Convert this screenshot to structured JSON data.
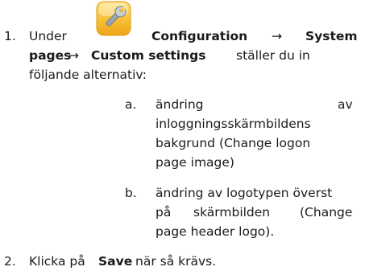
{
  "step1": {
    "number": "1.",
    "under": "Under",
    "configuration": "Configuration",
    "arrow1": "→",
    "system": "System",
    "pages": "pages",
    "arrow2": "→",
    "custom_settings": "Custom settings",
    "staller": "ställer du in",
    "following": "följande alternativ:",
    "icon": "wrench-settings-icon",
    "icon_color": "#f4b71b"
  },
  "sub_a": {
    "letter": "a.",
    "lines": [
      "ändring",
      "av",
      "inloggningsskärmbildens",
      "bakgrund (Change logon",
      "page image)"
    ]
  },
  "sub_b": {
    "letter": "b.",
    "lines": [
      "ändring av logotypen överst",
      "på",
      "skärmbilden",
      "(Change",
      "page header logo)."
    ]
  },
  "step2": {
    "number": "2.",
    "klicka": "Klicka på",
    "save": "Save",
    "rest": "när så krävs."
  }
}
